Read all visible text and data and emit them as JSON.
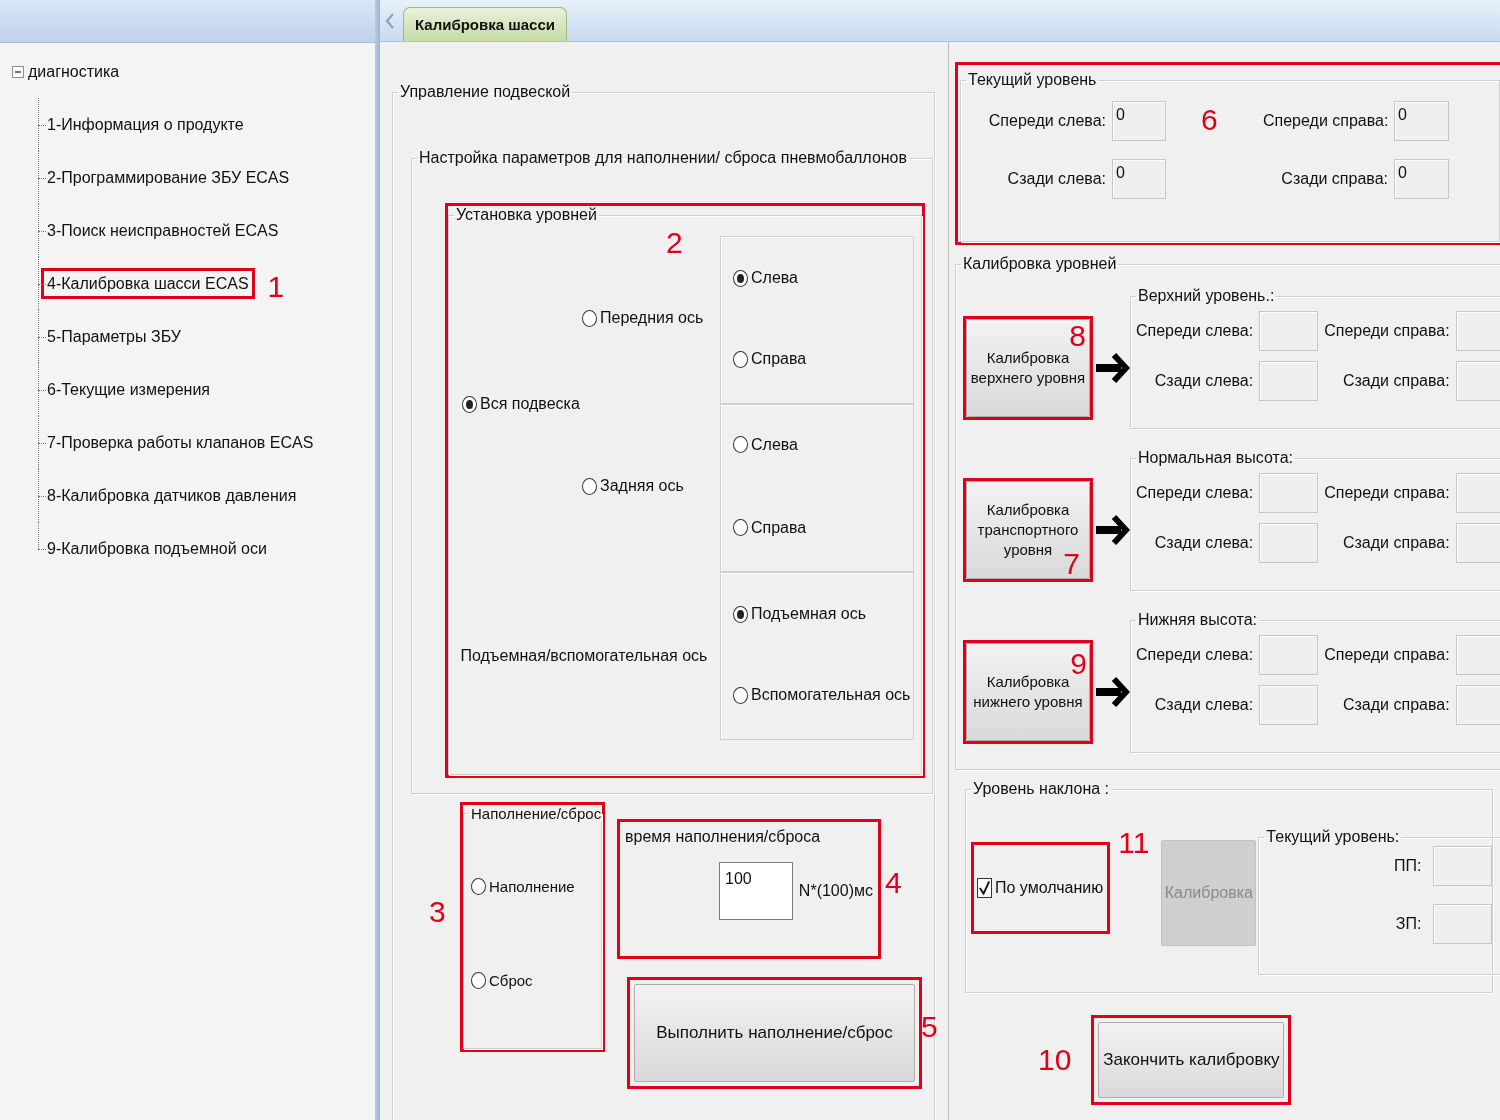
{
  "sidebar": {
    "tree": {
      "label": "диагностика",
      "expanded": true,
      "children": [
        {
          "label": "1-Информация о продукте"
        },
        {
          "label": "2-Программирование ЗБУ ECAS"
        },
        {
          "label": "3-Поиск неисправностей ECAS"
        },
        {
          "label": "4-Калибровка шасси ECAS",
          "callout": "1"
        },
        {
          "label": "5-Параметры ЗБУ"
        },
        {
          "label": "6-Текущие измерения"
        },
        {
          "label": "7-Проверка работы клапанов ECAS"
        },
        {
          "label": "8-Калибровка датчиков давления"
        },
        {
          "label": "9-Калибровка подъемной оси"
        }
      ]
    }
  },
  "tabs": [
    {
      "label": "Калибровка шасси",
      "selected": true
    }
  ],
  "suspension_control": {
    "title": "Управление подвеской",
    "settings": {
      "title": "Настройка параметров для наполнении/ сброса пневмобаллонов",
      "levels": {
        "title": "Установка уровней",
        "callout": "2",
        "whole": {
          "label": "Вся подвеска",
          "selected": true
        },
        "axles": [
          {
            "kind": "radio",
            "label": "Передния ось",
            "selected": false,
            "sides": [
              {
                "label": "Слева",
                "selected": true
              },
              {
                "label": "Справа",
                "selected": false
              }
            ]
          },
          {
            "kind": "radio",
            "label": "Задняя ось",
            "selected": false,
            "sides": [
              {
                "label": "Слева",
                "selected": false
              },
              {
                "label": "Справа",
                "selected": false
              }
            ]
          },
          {
            "kind": "label",
            "label": "Подъемная/вспомогательная ось",
            "sides": [
              {
                "label": "Подъемная ось",
                "selected": true
              },
              {
                "label": "Вспомогательная ось",
                "selected": false
              }
            ]
          }
        ]
      }
    },
    "fill_reset": {
      "title": "Наполнение/сброс",
      "callout": "3",
      "options": [
        {
          "label": "Наполнение",
          "selected": false
        },
        {
          "label": "Сброс",
          "selected": false
        }
      ]
    },
    "fill_time": {
      "title": "время наполнения/сброса",
      "value": "100",
      "unit": "N*(100)мс",
      "callout": "4"
    },
    "execute_button": {
      "label": "Выполнить наполнение/сброс",
      "callout": "5"
    }
  },
  "current_level": {
    "title": "Текущий уровень",
    "callout": "6",
    "fields": [
      {
        "label": "Спереди слева:",
        "value": "0"
      },
      {
        "label": "Спереди справа:",
        "value": "0"
      },
      {
        "label": "Сзади слева:",
        "value": "0"
      },
      {
        "label": "Сзади справа:",
        "value": "0"
      }
    ]
  },
  "level_calibration": {
    "title": "Калибровка уровней",
    "rows": [
      {
        "button": "Калибровка верхнего уровня",
        "callout": "8",
        "group": "Верхний уровень.:",
        "fields": [
          {
            "label": "Спереди слева:"
          },
          {
            "label": "Спереди справа:"
          },
          {
            "label": "Сзади слева:"
          },
          {
            "label": "Сзади справа:"
          }
        ]
      },
      {
        "button": "Калибровка транспортного уровня",
        "callout": "7",
        "group": "Нормальная высота:",
        "fields": [
          {
            "label": "Спереди слева:"
          },
          {
            "label": "Спереди справа:"
          },
          {
            "label": "Сзади слева:"
          },
          {
            "label": "Сзади справа:"
          }
        ]
      },
      {
        "button": "Калибровка нижнего уровня",
        "callout": "9",
        "group": "Нижняя высота:",
        "fields": [
          {
            "label": "Спереди слева:"
          },
          {
            "label": "Спереди справа:"
          },
          {
            "label": "Сзади слева:"
          },
          {
            "label": "Сзади справа:"
          }
        ]
      }
    ]
  },
  "tilt_level": {
    "title": "Уровень наклона :",
    "default_option": {
      "label": "По умолчанию",
      "checked": true,
      "callout": "11"
    },
    "calibrate_button": {
      "label": "Калибровка",
      "disabled": true
    },
    "current": {
      "title": "Текущий уровень:",
      "fields": [
        {
          "label": "ПП:"
        },
        {
          "label": "ЗП:"
        }
      ]
    }
  },
  "finish_button": {
    "label": "Закончить калибровку",
    "callout": "10"
  }
}
